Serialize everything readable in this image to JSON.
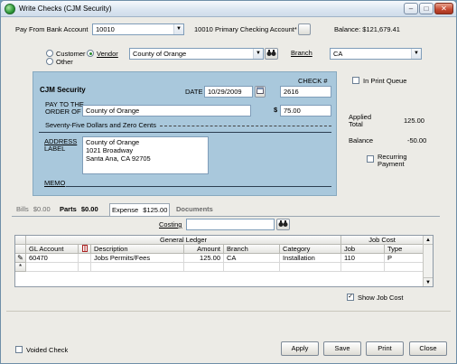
{
  "window": {
    "title": "Write Checks  (CJM Security)",
    "minimize": "–",
    "maximize": "□",
    "close": "✕"
  },
  "top": {
    "pay_from_label": "Pay From Bank Account",
    "bank_account_value": "10010",
    "bank_account_name": "10010 Primary Checking Account*",
    "balance_text": "Balance: $121,679.41"
  },
  "payee": {
    "customer_label": "Customer",
    "vendor_label": "Vendor",
    "other_label": "Other",
    "selected": "Vendor",
    "vendor_value": "County of Orange",
    "branch_label": "Branch",
    "branch_value": "CA",
    "in_print_queue_label": "In Print Queue"
  },
  "check": {
    "company": "CJM Security",
    "check_num_label": "CHECK #",
    "check_num_value": "2616",
    "date_label": "DATE",
    "date_value": "10/29/2009",
    "pay_to_label_1": "PAY TO THE",
    "pay_to_label_2": "ORDER OF",
    "pay_to_value": "County of Orange",
    "dollar_sign": "$",
    "amount_value": "75.00",
    "written_amount": "Seventy-Five Dollars and Zero Cents",
    "address_label_1": "ADDRESS",
    "address_label_2": "LABEL",
    "address_lines": [
      "County of Orange",
      "1021 Broadway",
      "Santa Ana, CA  92705"
    ],
    "memo_label": "MEMO",
    "memo_value": ""
  },
  "summary": {
    "applied_label_1": "Applied",
    "applied_label_2": "Total",
    "applied_value": "125.00",
    "balance_label": "Balance",
    "balance_value": "-50.00",
    "recurring_label_1": "Recurring",
    "recurring_label_2": "Payment"
  },
  "tabs": [
    {
      "label": "Bills",
      "amount": "$0.00"
    },
    {
      "label": "Parts",
      "amount": "$0.00"
    },
    {
      "label": "Expense",
      "amount": "$125.00"
    },
    {
      "label": "Documents",
      "amount": ""
    }
  ],
  "active_tab": "Expense",
  "costing_label": "Costing",
  "costing_value": "",
  "grid": {
    "group_general_ledger": "General Ledger",
    "group_job_cost": "Job Cost",
    "columns": [
      "GL Account",
      "Description",
      "Amount",
      "Branch",
      "Category",
      "Job",
      "Type"
    ],
    "rows": [
      {
        "gl_account": "60470",
        "description": "Jobs Permits/Fees",
        "amount": "125.00",
        "branch": "CA",
        "category": "Installation",
        "job": "110",
        "type": "P"
      }
    ],
    "new_row_marker": "*",
    "edit_row_marker": "✎"
  },
  "show_job_cost_label": "Show Job Cost",
  "show_job_cost_checked": true,
  "voided_check_label": "Voided Check",
  "buttons": {
    "apply": "Apply",
    "save": "Save",
    "print": "Print",
    "close": "Close"
  }
}
